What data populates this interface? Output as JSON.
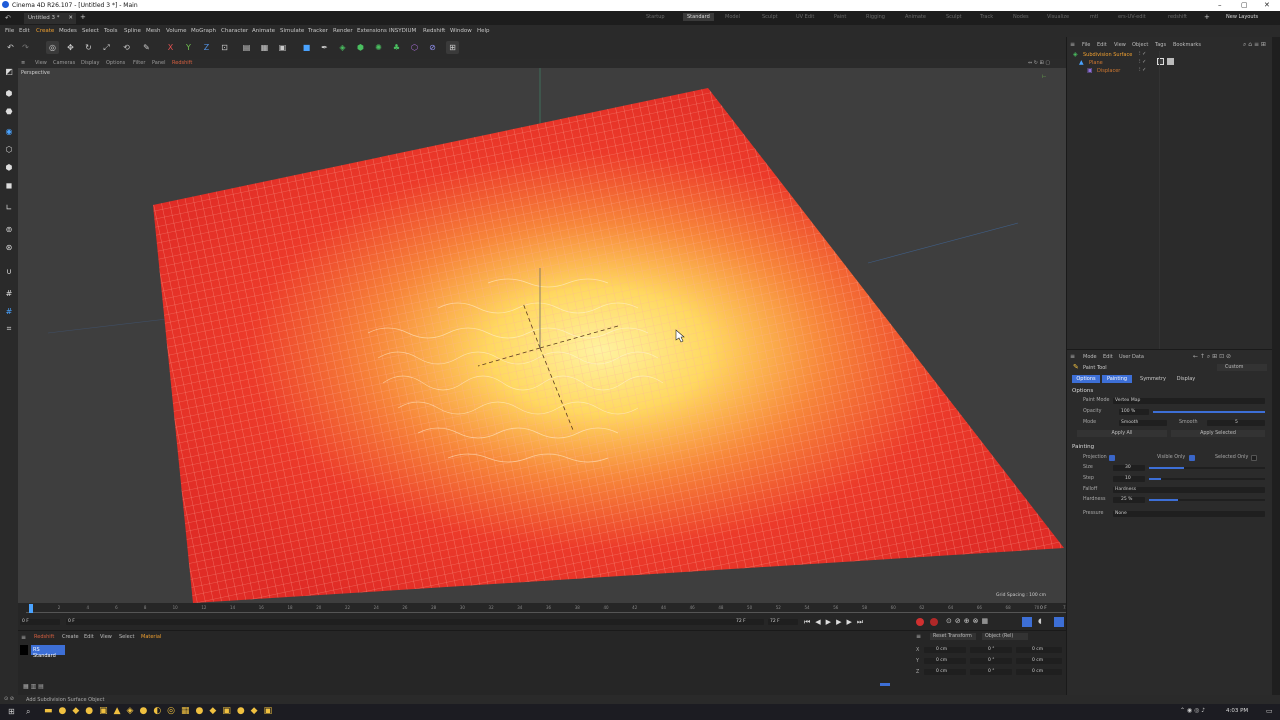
{
  "window": {
    "title": "Cinema 4D R26.107 - [Untitled 3 *] - Main",
    "doc_tab": "Untitled 3 *",
    "controls": [
      "–",
      "▢",
      "✕"
    ]
  },
  "layouts": {
    "items": [
      "Startup",
      "Standard",
      "Model",
      "Sculpt",
      "UV Edit",
      "Paint",
      "Rigging",
      "Animate",
      "Sculpt",
      "Track",
      "Nodes",
      "Visualize",
      "mtl",
      "ers-UV-edit",
      "redshift"
    ],
    "active": "Standard",
    "new_layouts": "New Layouts"
  },
  "menubar": [
    "File",
    "Edit",
    "Create",
    "Modes",
    "Select",
    "Tools",
    "Spline",
    "Mesh",
    "Volume",
    "MoGraph",
    "Character",
    "Animate",
    "Simulate",
    "Tracker",
    "Render",
    "Extensions",
    "INSYDIUM",
    "Redshift",
    "Window",
    "Help"
  ],
  "toolbar": {
    "axis_x": "X",
    "axis_y": "Y",
    "axis_z": "Z"
  },
  "viewport": {
    "menu": [
      "View",
      "Cameras",
      "Display",
      "Options",
      "Filter",
      "Panel",
      "Redshift"
    ],
    "camera_label": "Perspective",
    "grid_spacing": "Grid Spacing : 100 cm"
  },
  "timeline": {
    "ticks": [
      "0",
      "2",
      "4",
      "6",
      "8",
      "10",
      "12",
      "14",
      "16",
      "18",
      "20",
      "22",
      "24",
      "26",
      "28",
      "30",
      "32",
      "34",
      "36",
      "38",
      "40",
      "42",
      "44",
      "46",
      "48",
      "50",
      "52",
      "54",
      "56",
      "58",
      "60",
      "62",
      "64",
      "66",
      "68",
      "70",
      "72"
    ],
    "current_frame": "0 F",
    "start_frame": "0 F",
    "start_field": "0 F",
    "end_field": "72 F",
    "end_field_2": "72 F"
  },
  "material_manager": {
    "menu": [
      "Redshift",
      "Create",
      "Edit",
      "View",
      "Select",
      "Material"
    ],
    "material_name": "RS Standard"
  },
  "coordinates": {
    "reset_button": "Reset Transform",
    "mode_select": "Object (Rel)",
    "rows": [
      {
        "axis": "X",
        "pos": "0 cm",
        "rot": "0 °",
        "scale": "0 cm"
      },
      {
        "axis": "Y",
        "pos": "0 cm",
        "rot": "0 °",
        "scale": "0 cm"
      },
      {
        "axis": "Z",
        "pos": "0 cm",
        "rot": "0 °",
        "scale": "0 cm"
      }
    ]
  },
  "object_manager": {
    "menu": [
      "File",
      "Edit",
      "View",
      "Object",
      "Tags",
      "Bookmarks"
    ],
    "objects": [
      {
        "name": "Subdivision Surface",
        "color": "#f0a030"
      },
      {
        "name": "Plane",
        "color": "#d07830"
      },
      {
        "name": "Displacer",
        "color": "#d07830"
      }
    ]
  },
  "attributes": {
    "menu": [
      "Mode",
      "Edit",
      "User Data"
    ],
    "tool_name": "Paint Tool",
    "preset": "Custom",
    "tabs": [
      "Options",
      "Painting",
      "Symmetry",
      "Display"
    ],
    "active_tabs": [
      "Options",
      "Painting"
    ],
    "options_header": "Options",
    "paint_mode_label": "Paint Mode",
    "paint_mode_value": "Vertex Map",
    "opacity_label": "Opacity",
    "opacity_value": "100 %",
    "opacity_level": 1.0,
    "mode_label": "Mode",
    "mode_value": "Smooth",
    "smooth_label": "Smooth",
    "smooth_value": "5",
    "apply_all": "Apply All",
    "apply_selected": "Apply Selected",
    "painting_header": "Painting",
    "projection_label": "Projection",
    "visible_only_label": "Visible Only",
    "selected_only_label": "Selected Only",
    "size_label": "Size",
    "size_value": "30",
    "size_level": 0.3,
    "step_label": "Step",
    "step_value": "10",
    "step_level": 0.1,
    "falloff_label": "Falloff",
    "falloff_value": "Hardness",
    "hardness_label": "Hardness",
    "hardness_value": "25 %",
    "hardness_level": 0.25,
    "pressure_label": "Pressure",
    "pressure_value": "None"
  },
  "status": {
    "text": "Add Subdivision Surface Object"
  },
  "taskbar": {
    "time": "4:03 PM"
  },
  "colors": {
    "accent": "#3d6fd6",
    "plane_red": "#e8332a",
    "plane_yellow": "#ffe870",
    "record_red": "#d03030"
  }
}
